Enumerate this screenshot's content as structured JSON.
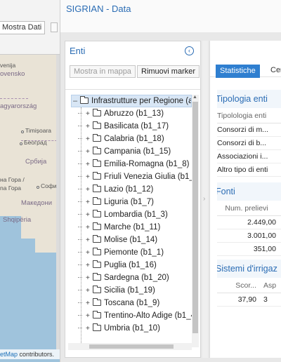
{
  "app": {
    "title": "SIGRIAN - Data"
  },
  "map": {
    "mostra_dati_label": "Mostra Dati",
    "labels": {
      "slovenia": "venija",
      "slovensko": "ovensko",
      "magyar": "agyarország",
      "timisoara": "Timișoara",
      "beograd": "Београд",
      "srbija": "Србија",
      "crna_gora1": "на Гора /",
      "crna_gora2": "na Гора",
      "sofia": "Софи",
      "makedonija": "Македони",
      "shqiperia": "Shqipëria"
    },
    "attribution_prefix": "etMap",
    "attribution_suffix": " contributors."
  },
  "enti": {
    "title": "Enti",
    "btn_mostra_mappa": "Mostra in mappa",
    "btn_rimuovi_marker": "Rimuovi marker",
    "root_label": "Infrastrutture per Regione (a",
    "items": [
      "Abruzzo (b1_13)",
      "Basilicata (b1_17)",
      "Calabria (b1_18)",
      "Campania (b1_15)",
      "Emilia-Romagna (b1_8)",
      "Friuli Venezia Giulia (b1_6",
      "Lazio (b1_12)",
      "Liguria (b1_7)",
      "Lombardia (b1_3)",
      "Marche (b1_11)",
      "Molise (b1_14)",
      "Piemonte (b1_1)",
      "Puglia (b1_16)",
      "Sardegna (b1_20)",
      "Sicilia (b1_19)",
      "Toscana (b1_9)",
      "Trentino-Alto Adige (b1_4",
      "Umbria (b1_10)"
    ]
  },
  "stats": {
    "tab_statistiche": "Statistiche",
    "tab_other": "Cen",
    "tipologia": {
      "title": "Tipologia enti",
      "header": "Tipolologia enti",
      "rows": [
        "Consorzi di m...",
        "Consorzi di b...",
        "Associazioni i...",
        "Altro tipo di enti"
      ]
    },
    "fonti": {
      "title": "Fonti",
      "header": "Num. prelievi",
      "rows": [
        "2.449,00",
        "3.001,00",
        "351,00"
      ]
    },
    "sistemi": {
      "title": "Sistemi d'irrigaz",
      "header_1": "Scor...",
      "header_2": "Asp",
      "row_1": "37,90",
      "row_2": "3"
    }
  }
}
